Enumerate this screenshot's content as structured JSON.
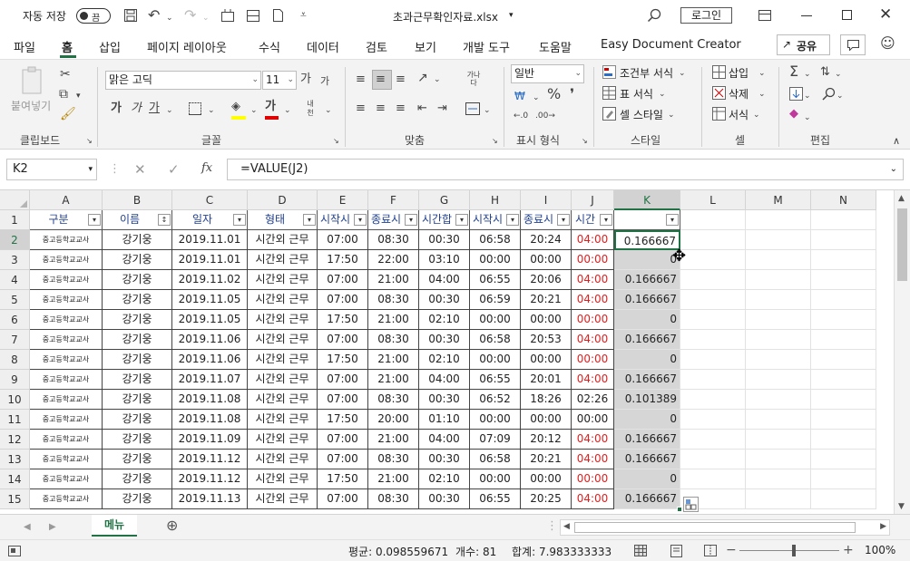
{
  "title_bar": {
    "autosave_label": "자동 저장",
    "autosave_state": "끔",
    "filename": "초과근무확인자료.xlsx",
    "login_label": "로그인"
  },
  "menu": {
    "tabs": [
      "파일",
      "홈",
      "삽입",
      "페이지 레이아웃",
      "수식",
      "데이터",
      "검토",
      "보기",
      "개발 도구",
      "도움말",
      "Easy Document Creator"
    ],
    "share_label": "공유"
  },
  "ribbon": {
    "clipboard": {
      "paste_label": "붙여넣기",
      "group_label": "클립보드"
    },
    "font": {
      "font_name": "맑은 고딕",
      "font_size": "11",
      "bold": "가",
      "italic": "가",
      "underline": "가",
      "grow": "가",
      "shrink": "가",
      "font_color_char": "가",
      "phonetic": "내천",
      "group_label": "글꼴"
    },
    "align": {
      "wrap": "가나다",
      "group_label": "맞춤"
    },
    "number": {
      "format": "일반",
      "group_label": "표시 형식"
    },
    "styles": {
      "cond_format": "조건부 서식",
      "table_format": "표 서식",
      "cell_styles": "셀 스타일",
      "group_label": "스타일"
    },
    "cells": {
      "insert": "삽입",
      "delete": "삭제",
      "format": "서식",
      "group_label": "셀"
    },
    "editing": {
      "group_label": "편집"
    }
  },
  "formula_bar": {
    "name_box": "K2",
    "formula": "=VALUE(J2)"
  },
  "columns": [
    "A",
    "B",
    "C",
    "D",
    "E",
    "F",
    "G",
    "H",
    "I",
    "J",
    "K",
    "L",
    "M",
    "N"
  ],
  "headers": [
    "구분",
    "이름",
    "일자",
    "형태",
    "시작시",
    "종료시",
    "시간합",
    "시작시",
    "종료시",
    "시간",
    ""
  ],
  "rows": [
    {
      "n": "2",
      "a": "중고등학교교사",
      "b": "강기웅",
      "c": "2019.11.01",
      "d": "시간외 근무",
      "e": "07:00",
      "f": "08:30",
      "g": "00:30",
      "h": "06:58",
      "i": "20:24",
      "j": "04:00",
      "j_red": true,
      "k": "0.166667"
    },
    {
      "n": "3",
      "a": "중고등학교교사",
      "b": "강기웅",
      "c": "2019.11.01",
      "d": "시간외 근무",
      "e": "17:50",
      "f": "22:00",
      "g": "03:10",
      "h": "00:00",
      "i": "00:00",
      "j": "00:00",
      "j_red": true,
      "k": "0"
    },
    {
      "n": "4",
      "a": "중고등학교교사",
      "b": "강기웅",
      "c": "2019.11.02",
      "d": "시간외 근무",
      "e": "07:00",
      "f": "21:00",
      "g": "04:00",
      "h": "06:55",
      "i": "20:06",
      "j": "04:00",
      "j_red": true,
      "k": "0.166667"
    },
    {
      "n": "5",
      "a": "중고등학교교사",
      "b": "강기웅",
      "c": "2019.11.05",
      "d": "시간외 근무",
      "e": "07:00",
      "f": "08:30",
      "g": "00:30",
      "h": "06:59",
      "i": "20:21",
      "j": "04:00",
      "j_red": true,
      "k": "0.166667"
    },
    {
      "n": "6",
      "a": "중고등학교교사",
      "b": "강기웅",
      "c": "2019.11.05",
      "d": "시간외 근무",
      "e": "17:50",
      "f": "21:00",
      "g": "02:10",
      "h": "00:00",
      "i": "00:00",
      "j": "00:00",
      "j_red": true,
      "k": "0"
    },
    {
      "n": "7",
      "a": "중고등학교교사",
      "b": "강기웅",
      "c": "2019.11.06",
      "d": "시간외 근무",
      "e": "07:00",
      "f": "08:30",
      "g": "00:30",
      "h": "06:58",
      "i": "20:53",
      "j": "04:00",
      "j_red": true,
      "k": "0.166667"
    },
    {
      "n": "8",
      "a": "중고등학교교사",
      "b": "강기웅",
      "c": "2019.11.06",
      "d": "시간외 근무",
      "e": "17:50",
      "f": "21:00",
      "g": "02:10",
      "h": "00:00",
      "i": "00:00",
      "j": "00:00",
      "j_red": true,
      "k": "0"
    },
    {
      "n": "9",
      "a": "중고등학교교사",
      "b": "강기웅",
      "c": "2019.11.07",
      "d": "시간외 근무",
      "e": "07:00",
      "f": "21:00",
      "g": "04:00",
      "h": "06:55",
      "i": "20:01",
      "j": "04:00",
      "j_red": true,
      "k": "0.166667"
    },
    {
      "n": "10",
      "a": "중고등학교교사",
      "b": "강기웅",
      "c": "2019.11.08",
      "d": "시간외 근무",
      "e": "07:00",
      "f": "08:30",
      "g": "00:30",
      "h": "06:52",
      "i": "18:26",
      "j": "02:26",
      "j_red": false,
      "k": "0.101389"
    },
    {
      "n": "11",
      "a": "중고등학교교사",
      "b": "강기웅",
      "c": "2019.11.08",
      "d": "시간외 근무",
      "e": "17:50",
      "f": "20:00",
      "g": "01:10",
      "h": "00:00",
      "i": "00:00",
      "j": "00:00",
      "j_red": false,
      "k": "0"
    },
    {
      "n": "12",
      "a": "중고등학교교사",
      "b": "강기웅",
      "c": "2019.11.09",
      "d": "시간외 근무",
      "e": "07:00",
      "f": "21:00",
      "g": "04:00",
      "h": "07:09",
      "i": "20:12",
      "j": "04:00",
      "j_red": true,
      "k": "0.166667"
    },
    {
      "n": "13",
      "a": "중고등학교교사",
      "b": "강기웅",
      "c": "2019.11.12",
      "d": "시간외 근무",
      "e": "07:00",
      "f": "08:30",
      "g": "00:30",
      "h": "06:58",
      "i": "20:21",
      "j": "04:00",
      "j_red": true,
      "k": "0.166667"
    },
    {
      "n": "14",
      "a": "중고등학교교사",
      "b": "강기웅",
      "c": "2019.11.12",
      "d": "시간외 근무",
      "e": "17:50",
      "f": "21:00",
      "g": "02:10",
      "h": "00:00",
      "i": "00:00",
      "j": "00:00",
      "j_red": true,
      "k": "0"
    },
    {
      "n": "15",
      "a": "중고등학교교사",
      "b": "강기웅",
      "c": "2019.11.13",
      "d": "시간외 근무",
      "e": "07:00",
      "f": "08:30",
      "g": "00:30",
      "h": "06:55",
      "i": "20:25",
      "j": "04:00",
      "j_red": true,
      "k": "0.166667"
    }
  ],
  "sheet_tab": "메뉴",
  "status": {
    "average": "평균: 0.098559671",
    "count": "개수: 81",
    "sum": "합계: 7.983333333",
    "zoom": "100%"
  },
  "colors": {
    "accent": "#217346",
    "red": "#e02020"
  }
}
